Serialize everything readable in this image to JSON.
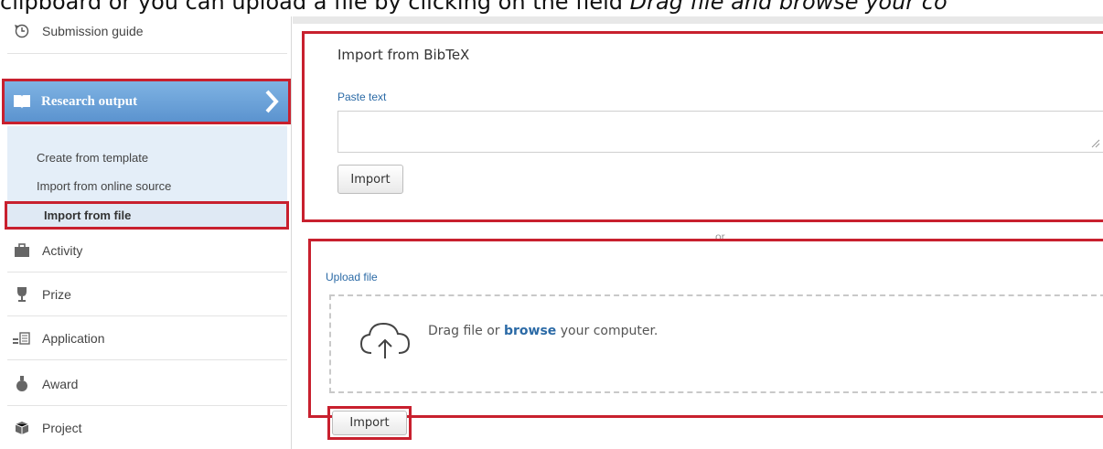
{
  "caption": {
    "prefix": "clipboard or you can upload a file by clicking on the field ",
    "emphasis": "Drag file and browse your co"
  },
  "sidebar": {
    "submission_guide": "Submission guide",
    "research_output": "Research output",
    "sub_items": [
      "Create from template",
      "Import from online source",
      "Import from file"
    ],
    "items": [
      {
        "label": "Activity",
        "icon": "briefcase-icon"
      },
      {
        "label": "Prize",
        "icon": "trophy-icon"
      },
      {
        "label": "Application",
        "icon": "application-icon"
      },
      {
        "label": "Award",
        "icon": "award-icon"
      },
      {
        "label": "Project",
        "icon": "project-icon"
      }
    ]
  },
  "bibtex": {
    "title": "Import from BibTeX",
    "paste_label": "Paste text",
    "paste_value": "",
    "import_label": "Import"
  },
  "separator": {
    "text": "or"
  },
  "upload": {
    "label": "Upload file",
    "drop_prefix": "Drag file or ",
    "drop_link": "browse",
    "drop_suffix": " your computer.",
    "import_label": "Import"
  },
  "colors": {
    "highlight": "#c8202e",
    "active_nav": "#6aa2d8",
    "link": "#2b6aa6"
  }
}
